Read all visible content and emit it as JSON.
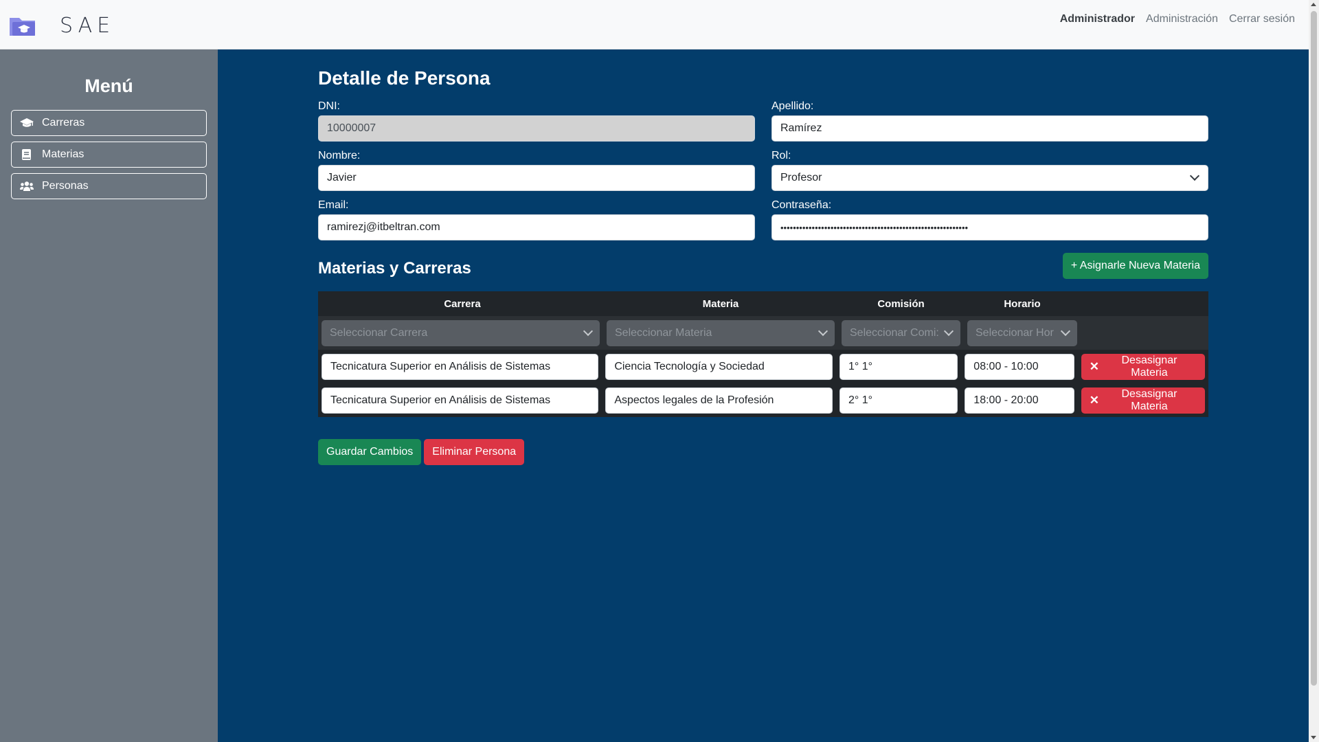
{
  "header": {
    "logo_text": "SAE",
    "nav": [
      "Administrador",
      "Administración",
      "Cerrar sesión"
    ]
  },
  "sidebar": {
    "title": "Menú",
    "items": [
      {
        "label": "Carreras",
        "icon": "graduation-cap-icon"
      },
      {
        "label": "Materias",
        "icon": "book-icon"
      },
      {
        "label": "Personas",
        "icon": "users-icon"
      }
    ]
  },
  "page": {
    "title": "Detalle de Persona",
    "fields": {
      "dni_label": "DNI:",
      "dni_value": "10000007",
      "apellido_label": "Apellido:",
      "apellido_value": "Ramírez",
      "nombre_label": "Nombre:",
      "nombre_value": "Javier",
      "rol_label": "Rol:",
      "rol_value": "Profesor",
      "email_label": "Email:",
      "email_value": "ramirezj@itbeltran.com",
      "password_label": "Contraseña:",
      "password_value": "••••••••••••••••••••••••••••••••••••••••••••••••••••••••••••"
    },
    "section_title": "Materias y Carreras",
    "assign_button": "+ Asignarle Nueva Materia",
    "table": {
      "headers": [
        "Carrera",
        "Materia",
        "Comisión",
        "Horario"
      ],
      "filters": [
        "Seleccionar Carrera",
        "Seleccionar Materia",
        "Seleccionar Comi:",
        "Seleccionar Hor"
      ],
      "rows": [
        {
          "carrera": "Tecnicatura Superior en Análisis de Sistemas",
          "materia": "Ciencia Tecnología y Sociedad",
          "comision": "1° 1°",
          "horario": "08:00 - 10:00",
          "action": "Desasignar Materia"
        },
        {
          "carrera": "Tecnicatura Superior en Análisis de Sistemas",
          "materia": "Aspectos legales de la Profesión",
          "comision": "2° 1°",
          "horario": "18:00 - 20:00",
          "action": "Desasignar Materia"
        }
      ]
    },
    "save_button": "Guardar Cambios",
    "delete_button": "Eliminar Persona"
  },
  "colors": {
    "main_bg": "#033d6b",
    "sidebar_bg": "#6b757f",
    "success": "#198754",
    "danger": "#dc3545"
  }
}
